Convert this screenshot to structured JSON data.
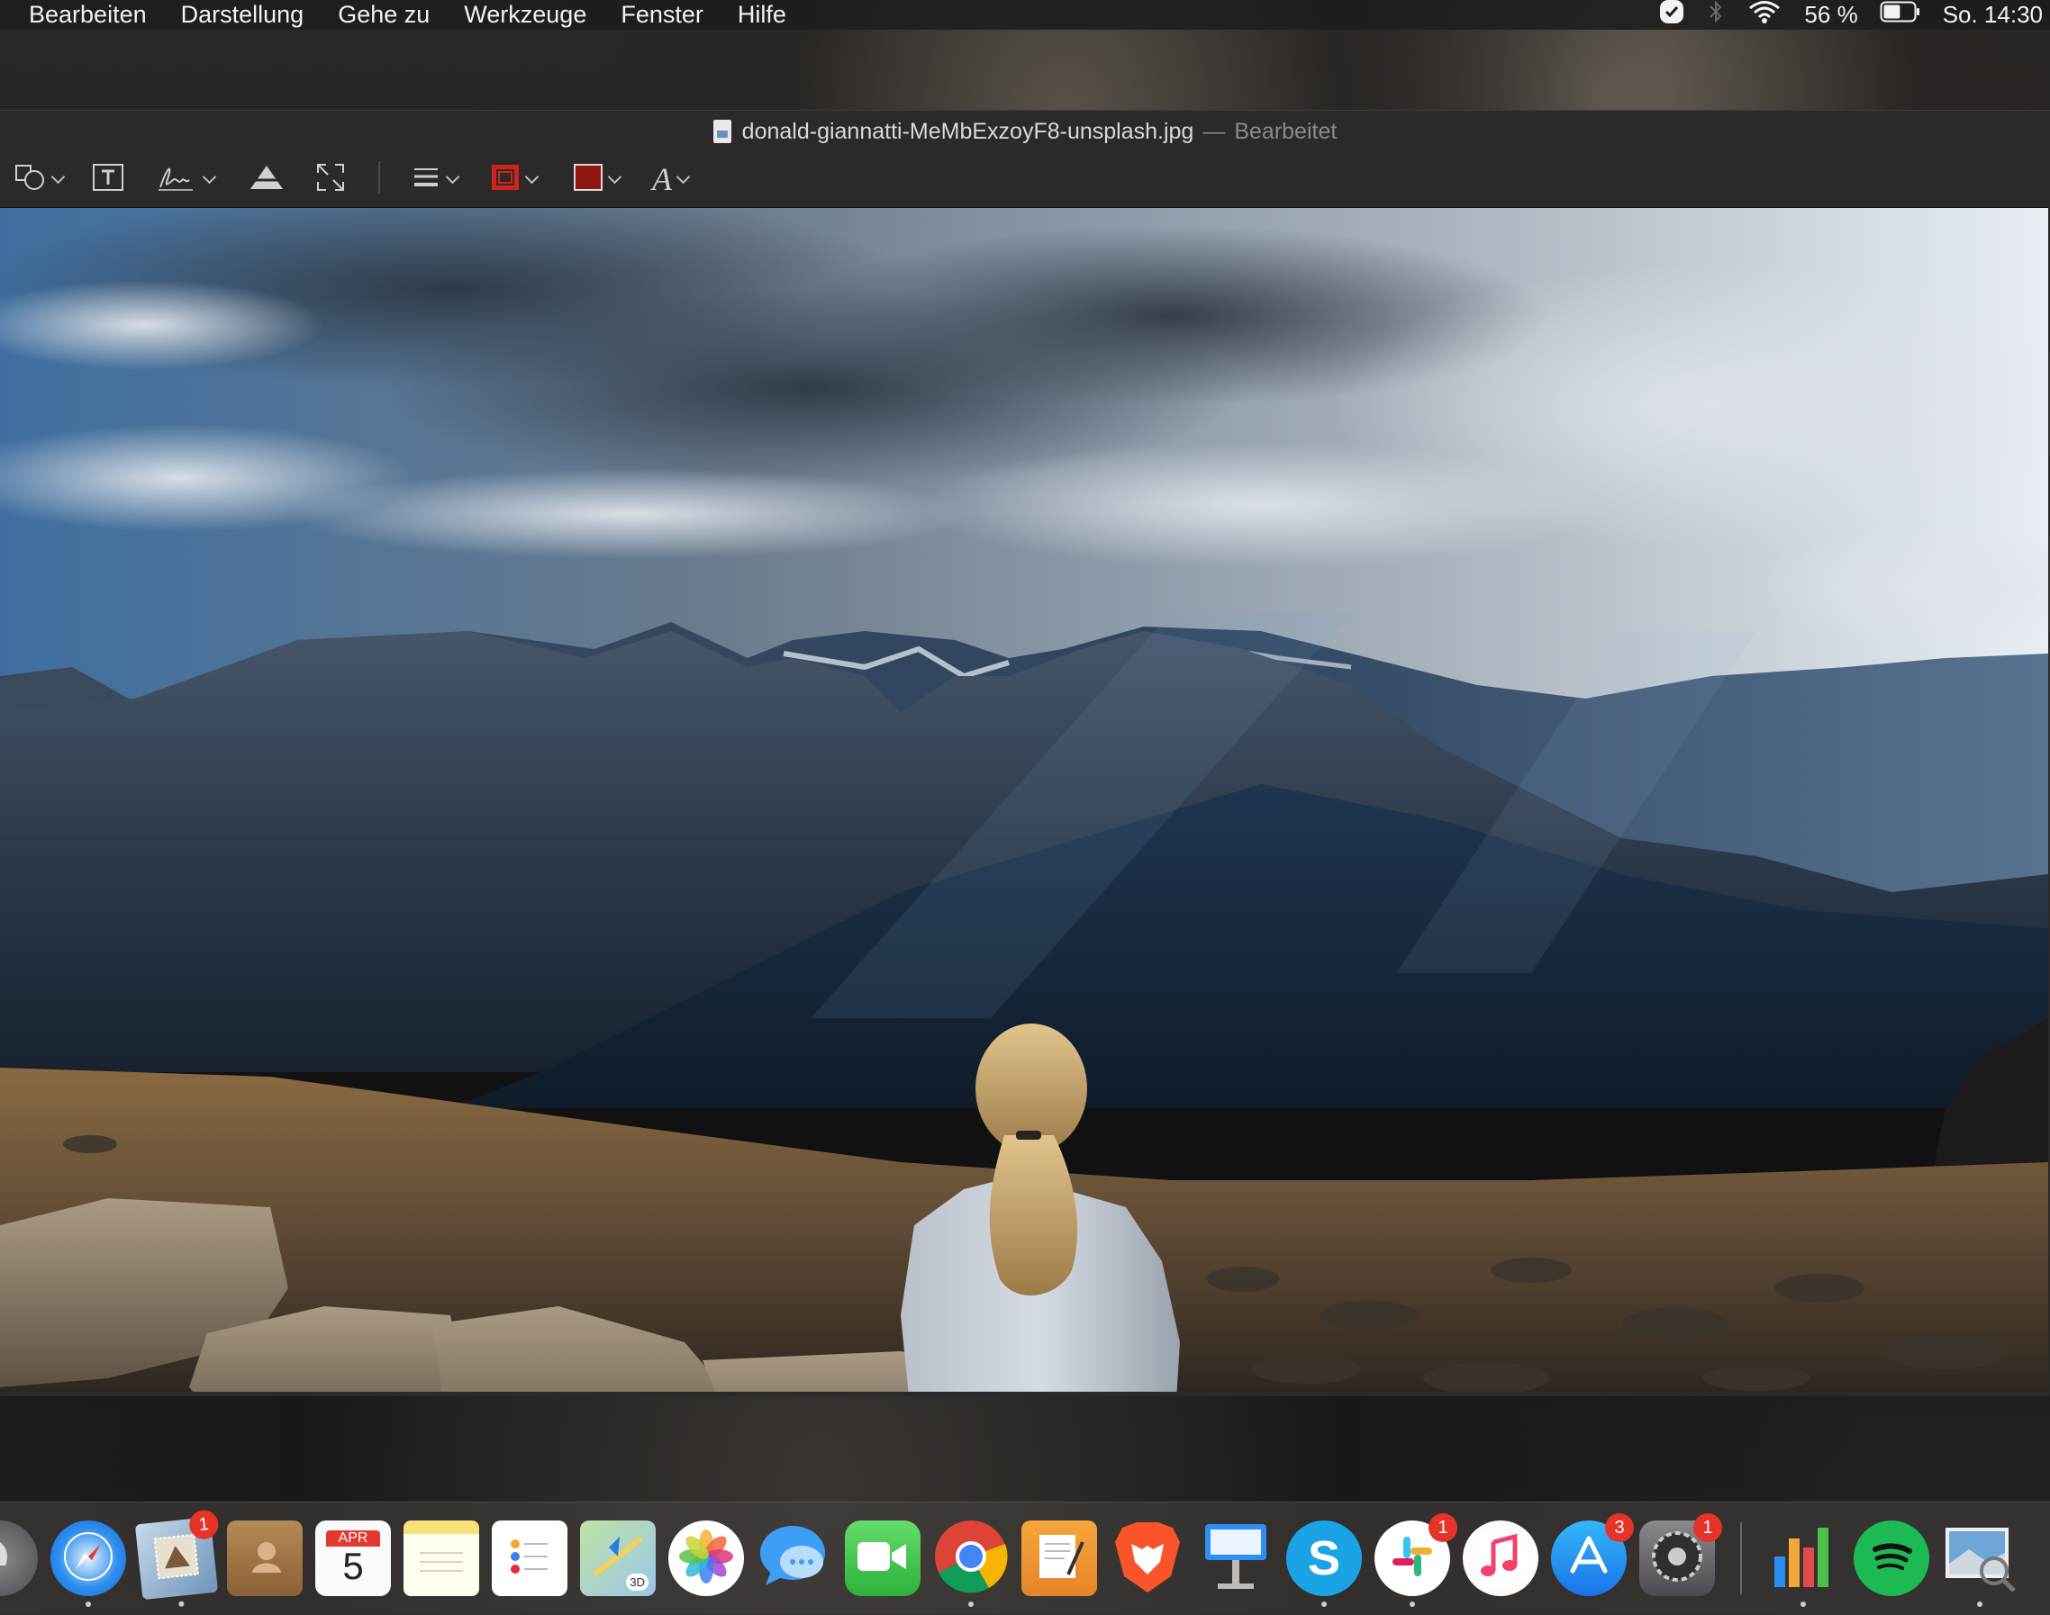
{
  "menubar": {
    "menus": [
      "Bearbeiten",
      "Darstellung",
      "Gehe zu",
      "Werkzeuge",
      "Fenster",
      "Hilfe"
    ],
    "battery_percent": "56 %",
    "clock": "So. 14:30",
    "battery_level": 0.56,
    "status_icons": [
      "checkmark-icon",
      "bluetooth-icon",
      "wifi-icon",
      "battery-icon"
    ]
  },
  "window": {
    "filename": "donald-giannatti-MeMbExzoyF8-unsplash.jpg",
    "separator": "—",
    "status": "Bearbeitet",
    "toolbar": {
      "tools": [
        "shapes-tool",
        "text-tool",
        "signature-tool",
        "adjust-color-tool",
        "adjust-size-tool",
        "line-style-tool",
        "border-color-tool",
        "fill-color-tool",
        "text-style-tool"
      ],
      "text_style_glyph": "A",
      "border_color": "#d0231a",
      "fill_color": "#8e1712"
    }
  },
  "calendar": {
    "month": "APR",
    "day": "5"
  },
  "dock": {
    "apps": [
      {
        "name": "Launchpad",
        "badge": ""
      },
      {
        "name": "Safari",
        "badge": ""
      },
      {
        "name": "Mail",
        "badge": "1"
      },
      {
        "name": "Kontakte",
        "badge": ""
      },
      {
        "name": "Kalender",
        "badge": ""
      },
      {
        "name": "Notizen",
        "badge": ""
      },
      {
        "name": "Erinnerungen",
        "badge": ""
      },
      {
        "name": "Karten",
        "badge": ""
      },
      {
        "name": "Fotos",
        "badge": ""
      },
      {
        "name": "Nachrichten",
        "badge": ""
      },
      {
        "name": "FaceTime",
        "badge": ""
      },
      {
        "name": "Chrome",
        "badge": ""
      },
      {
        "name": "Pages",
        "badge": ""
      },
      {
        "name": "Brave",
        "badge": ""
      },
      {
        "name": "Keynote",
        "badge": ""
      },
      {
        "name": "Skype",
        "badge": ""
      },
      {
        "name": "Slack",
        "badge": "1"
      },
      {
        "name": "Musik",
        "badge": ""
      },
      {
        "name": "App Store",
        "badge": "3"
      },
      {
        "name": "Systemeinstellungen",
        "badge": "1"
      },
      {
        "name": "Numbers",
        "badge": ""
      },
      {
        "name": "Spotify",
        "badge": ""
      },
      {
        "name": "Vorschau",
        "badge": ""
      }
    ],
    "maps_badge_text": "3D",
    "skype_letter": "S"
  }
}
